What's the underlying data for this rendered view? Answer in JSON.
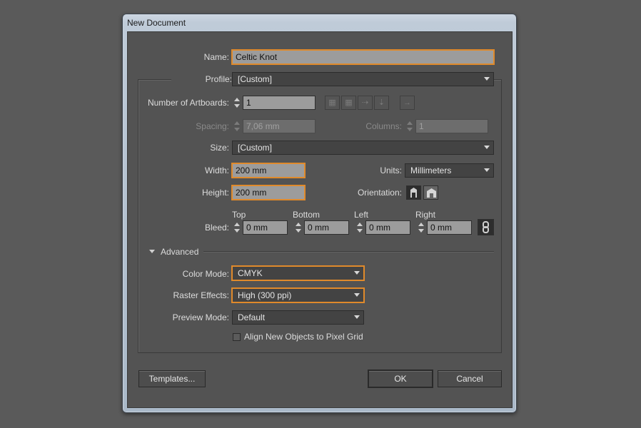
{
  "window": {
    "title": "New Document"
  },
  "form": {
    "name_label": "Name:",
    "name_value": "Celtic Knot",
    "profile_label": "Profile:",
    "profile_value": "[Custom]",
    "artboards_label": "Number of Artboards:",
    "artboards_value": "1",
    "spacing_label": "Spacing:",
    "spacing_value": "7,06 mm",
    "columns_label": "Columns:",
    "columns_value": "1",
    "size_label": "Size:",
    "size_value": "[Custom]",
    "width_label": "Width:",
    "width_value": "200 mm",
    "units_label": "Units:",
    "units_value": "Millimeters",
    "height_label": "Height:",
    "height_value": "200 mm",
    "orientation_label": "Orientation:",
    "bleed_label": "Bleed:",
    "bleed_top_label": "Top",
    "bleed_top_value": "0 mm",
    "bleed_bottom_label": "Bottom",
    "bleed_bottom_value": "0 mm",
    "bleed_left_label": "Left",
    "bleed_left_value": "0 mm",
    "bleed_right_label": "Right",
    "bleed_right_value": "0 mm"
  },
  "advanced": {
    "label": "Advanced",
    "color_mode_label": "Color Mode:",
    "color_mode_value": "CMYK",
    "raster_label": "Raster Effects:",
    "raster_value": "High (300 ppi)",
    "preview_label": "Preview Mode:",
    "preview_value": "Default",
    "align_pixel_label": "Align New Objects to Pixel Grid"
  },
  "buttons": {
    "templates": "Templates...",
    "ok": "OK",
    "cancel": "Cancel"
  },
  "colors": {
    "focus_highlight": "#e08a2b",
    "panel_bg": "#535353"
  }
}
